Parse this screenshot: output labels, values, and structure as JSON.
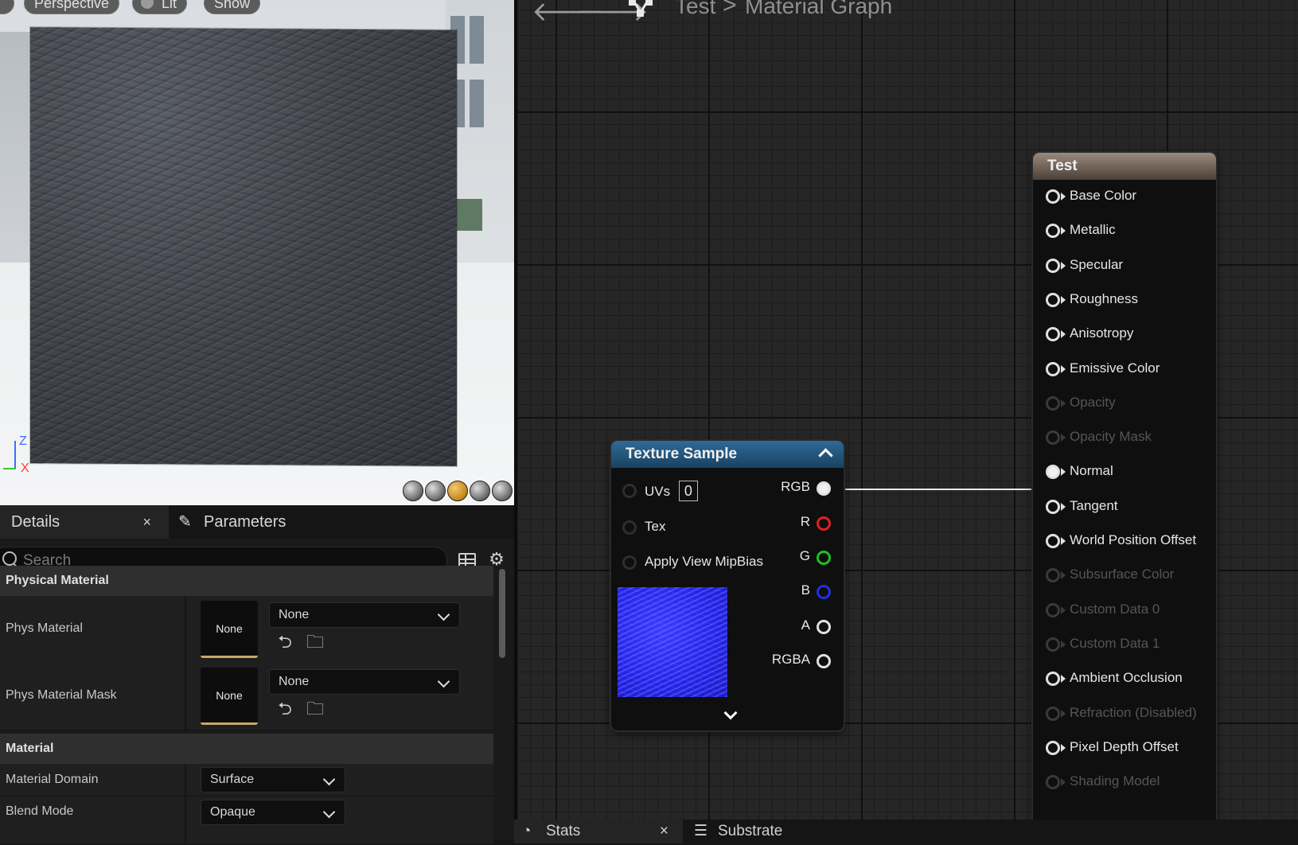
{
  "viewport": {
    "buttons": [
      "Perspective",
      "Lit",
      "Show"
    ],
    "axis": {
      "z": "Z",
      "x": "X"
    }
  },
  "details": {
    "tabs": {
      "details": "Details",
      "close": "×",
      "parameters": "Parameters"
    },
    "search": {
      "placeholder": "Search"
    },
    "sections": {
      "physical_material": "Physical Material",
      "material": "Material"
    },
    "phys_material": {
      "label": "Phys Material",
      "thumb": "None",
      "value": "None"
    },
    "phys_material_mask": {
      "label": "Phys Material Mask",
      "thumb": "None",
      "value": "None"
    },
    "material_domain": {
      "label": "Material Domain",
      "value": "Surface"
    },
    "blend_mode": {
      "label": "Blend Mode",
      "value": "Opaque"
    }
  },
  "graph": {
    "breadcrumb": {
      "asset": "Test",
      "separator": ">",
      "graph": "Material Graph"
    },
    "texture_sample": {
      "title": "Texture Sample",
      "inputs": {
        "uvs": "UVs",
        "uvs_value": "0",
        "tex": "Tex",
        "mipbias": "Apply View MipBias"
      },
      "outputs": {
        "rgb": "RGB",
        "r": "R",
        "g": "G",
        "b": "B",
        "a": "A",
        "rgba": "RGBA"
      },
      "colors": {
        "r": "#e02020",
        "g": "#20c020",
        "b": "#2030e0"
      }
    },
    "output_node": {
      "title": "Test",
      "pins": [
        {
          "label": "Base Color",
          "enabled": true
        },
        {
          "label": "Metallic",
          "enabled": true
        },
        {
          "label": "Specular",
          "enabled": true
        },
        {
          "label": "Roughness",
          "enabled": true
        },
        {
          "label": "Anisotropy",
          "enabled": true
        },
        {
          "label": "Emissive Color",
          "enabled": true
        },
        {
          "label": "Opacity",
          "enabled": false
        },
        {
          "label": "Opacity Mask",
          "enabled": false
        },
        {
          "label": "Normal",
          "enabled": true,
          "connected": true
        },
        {
          "label": "Tangent",
          "enabled": true
        },
        {
          "label": "World Position Offset",
          "enabled": true
        },
        {
          "label": "Subsurface Color",
          "enabled": false
        },
        {
          "label": "Custom Data 0",
          "enabled": false
        },
        {
          "label": "Custom Data 1",
          "enabled": false
        },
        {
          "label": "Ambient Occlusion",
          "enabled": true
        },
        {
          "label": "Refraction (Disabled)",
          "enabled": false
        },
        {
          "label": "Pixel Depth Offset",
          "enabled": true
        },
        {
          "label": "Shading Model",
          "enabled": false
        }
      ]
    }
  },
  "bottom_tabs": {
    "stats": "Stats",
    "close": "×",
    "substrate": "Substrate"
  }
}
